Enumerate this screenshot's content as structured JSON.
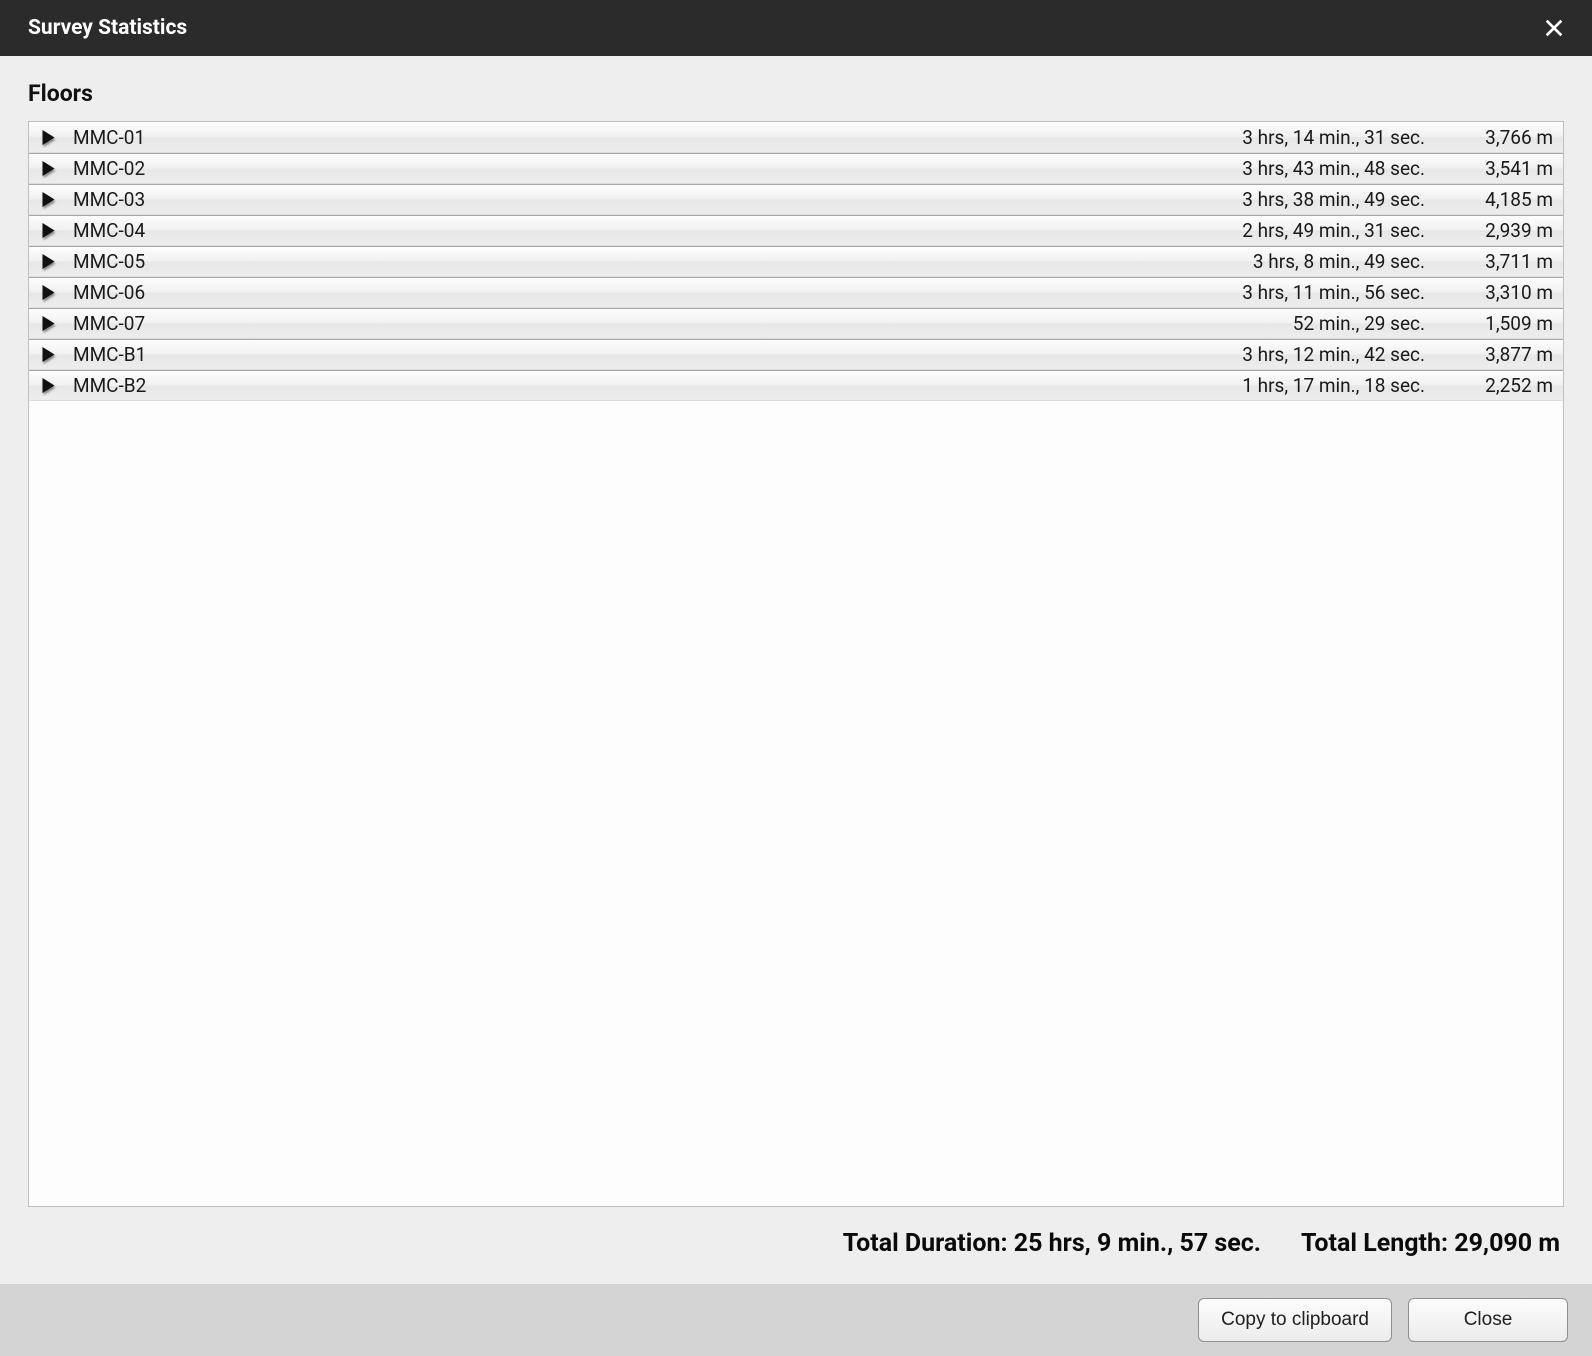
{
  "window": {
    "title": "Survey Statistics"
  },
  "section": {
    "title": "Floors"
  },
  "rows": [
    {
      "name": "MMC-01",
      "duration": "3 hrs, 14 min., 31 sec.",
      "length": "3,766 m"
    },
    {
      "name": "MMC-02",
      "duration": "3 hrs, 43 min., 48 sec.",
      "length": "3,541 m"
    },
    {
      "name": "MMC-03",
      "duration": "3 hrs, 38 min., 49 sec.",
      "length": "4,185 m"
    },
    {
      "name": "MMC-04",
      "duration": "2 hrs, 49 min., 31 sec.",
      "length": "2,939 m"
    },
    {
      "name": "MMC-05",
      "duration": "3 hrs, 8 min., 49 sec.",
      "length": "3,711 m"
    },
    {
      "name": "MMC-06",
      "duration": "3 hrs, 11 min., 56 sec.",
      "length": "3,310 m"
    },
    {
      "name": "MMC-07",
      "duration": "52 min., 29 sec.",
      "length": "1,509 m"
    },
    {
      "name": "MMC-B1",
      "duration": "3 hrs, 12 min., 42 sec.",
      "length": "3,877 m"
    },
    {
      "name": "MMC-B2",
      "duration": "1 hrs, 17 min., 18 sec.",
      "length": "2,252 m"
    }
  ],
  "totals": {
    "duration_label": "Total Duration:",
    "duration_value": "25 hrs, 9 min., 57 sec.",
    "length_label": "Total Length:",
    "length_value": "29,090 m"
  },
  "footer": {
    "copy_label": "Copy to clipboard",
    "close_label": "Close"
  }
}
